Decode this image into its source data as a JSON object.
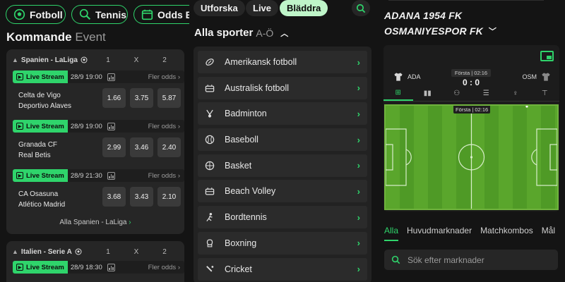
{
  "left": {
    "chips": [
      {
        "label": "Fotboll",
        "icon": "soccer-ball-icon"
      },
      {
        "label": "Tennis",
        "icon": "tennis-icon"
      },
      {
        "label": "Odds Bo",
        "icon": "calendar-icon"
      }
    ],
    "heading": {
      "bold": "Kommande",
      "light": "Event"
    },
    "cards": [
      {
        "league": "Spanien - LaLiga",
        "cols": [
          "1",
          "X",
          "2"
        ],
        "matches": [
          {
            "live": "Live Stream",
            "time": "28/9 19:00",
            "more": "Fler odds",
            "home": "Celta de Vigo",
            "away": "Deportivo Alaves",
            "odds": [
              "1.66",
              "3.75",
              "5.87"
            ]
          },
          {
            "live": "Live Stream",
            "time": "28/9 19:00",
            "more": "Fler odds",
            "home": "Granada CF",
            "away": "Real Betis",
            "odds": [
              "2.99",
              "3.46",
              "2.40"
            ]
          },
          {
            "live": "Live Stream",
            "time": "28/9 21:30",
            "more": "Fler odds",
            "home": "CA Osasuna",
            "away": "Atlético Madrid",
            "odds": [
              "3.68",
              "3.43",
              "2.10"
            ]
          }
        ],
        "all_link": "Alla Spanien - LaLiga"
      },
      {
        "league": "Italien - Serie A",
        "cols": [
          "1",
          "X",
          "2"
        ],
        "matches": [
          {
            "live": "Live Stream",
            "time": "28/9 18:30",
            "more": "Fler odds"
          }
        ]
      }
    ]
  },
  "middle": {
    "tabs": [
      "Utforska",
      "Live",
      "Bläddra"
    ],
    "active_tab": "Bläddra",
    "heading": {
      "bold": "Alla sporter",
      "light": "A-Ö"
    },
    "sports": [
      {
        "label": "Amerikansk fotboll",
        "icon": "american-football-icon"
      },
      {
        "label": "Australisk fotboll",
        "icon": "stadium-icon"
      },
      {
        "label": "Badminton",
        "icon": "badminton-icon"
      },
      {
        "label": "Baseboll",
        "icon": "baseball-icon"
      },
      {
        "label": "Basket",
        "icon": "basketball-icon"
      },
      {
        "label": "Beach Volley",
        "icon": "stadium-icon"
      },
      {
        "label": "Bordtennis",
        "icon": "table-tennis-icon"
      },
      {
        "label": "Boxning",
        "icon": "boxing-glove-icon"
      },
      {
        "label": "Cricket",
        "icon": "cricket-icon"
      }
    ]
  },
  "right": {
    "title_line1": "ADANA 1954 FK",
    "title_line2": "OSMANIYESPOR FK",
    "home": "ADA",
    "away": "OSM",
    "period": "Första",
    "clock": "02:16",
    "score": "0 : 0",
    "pitch_period": "Första",
    "pitch_clock": "02:16",
    "market_tabs": [
      "Alla",
      "Huvudmarknader",
      "Matchkombos",
      "Mål"
    ],
    "search_placeholder": "Sök efter marknader"
  },
  "colors": {
    "accent": "#2fd46b",
    "active_tab_bg": "#bff5c9",
    "pitch": "#5aa62c"
  }
}
